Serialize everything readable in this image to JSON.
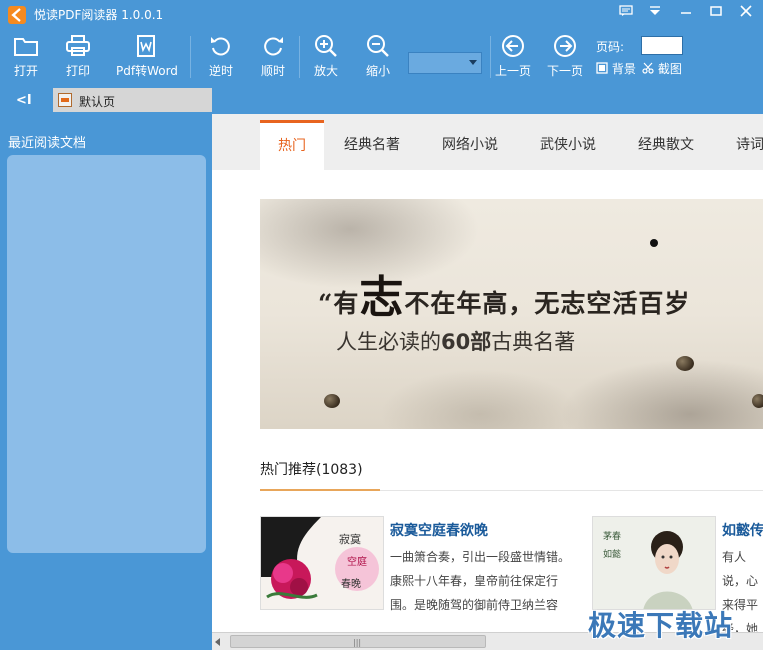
{
  "window": {
    "title": "悦读PDF阅读器 1.0.0.1"
  },
  "toolbar": {
    "open": "打开",
    "print": "打印",
    "pdf_to_word": "Pdf转Word",
    "rotate_ccw": "逆时",
    "rotate_cw": "顺时",
    "zoom_in": "放大",
    "zoom_out": "缩小",
    "zoom_value": "",
    "prev_page": "上一页",
    "next_page": "下一页",
    "page_label": "页码:",
    "page_value": "",
    "background": "背景",
    "screenshot": "截图"
  },
  "tabs": {
    "collapse": "<I",
    "default_tab": "默认页"
  },
  "sidebar": {
    "heading": "最近阅读文档"
  },
  "categories": [
    "热门",
    "经典名著",
    "网络小说",
    "武侠小说",
    "经典散文",
    "诗词"
  ],
  "banner": {
    "quote_open": "“有",
    "quote_big": "志",
    "quote_rest": "不在年高，无志空活百岁",
    "subtitle_pre": "人生必读的",
    "subtitle_bold": "60部",
    "subtitle_post": "古典名著"
  },
  "section": {
    "title": "热门推荐(1083)"
  },
  "books": [
    {
      "title": "寂寞空庭春欲晚",
      "desc": "一曲箫合奏，引出一段盛世情错。康熙十八年春，皇帝前往保定行围。是晚随驾的御前侍卫纳兰容"
    },
    {
      "title": "如懿传",
      "desc": "有人说，心来得平经，她必"
    }
  ],
  "watermark": "极速下载站"
}
